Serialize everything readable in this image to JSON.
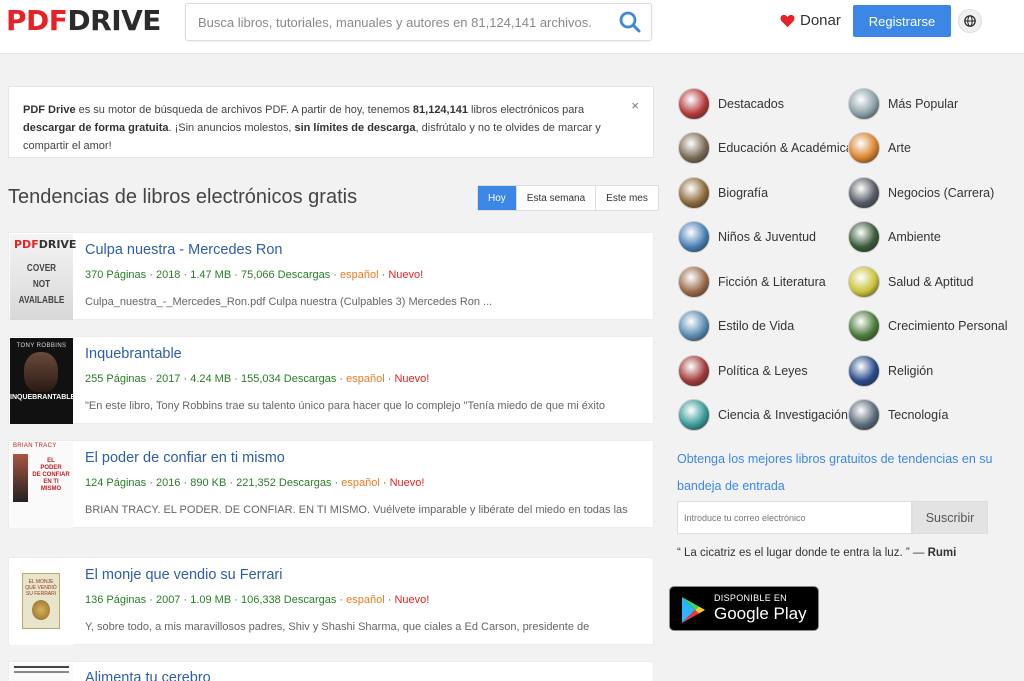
{
  "header": {
    "logo_pdf": "PDF",
    "logo_drive": "DRIVE",
    "search_placeholder": "Busca libros, tutoriales, manuales y autores en 81,124,141 archivos.",
    "donate_label": "Donar",
    "register_label": "Registrarse",
    "search_icon": "search-icon",
    "language_icon": "globe-icon"
  },
  "notice": {
    "p1": "PDF Drive",
    "p2": " es su motor de búsqueda de archivos PDF. A partir de hoy, tenemos ",
    "p3": "81,124,141",
    "p4": " libros electrónicos para ",
    "p5": "descargar de forma gratuita",
    "p6": ". ¡Sin anuncios molestos, ",
    "p7": "sin límites de descarga",
    "p8": ", disfrútalo y no te olvides de marcar y compartir el amor!",
    "close": "×"
  },
  "trending": {
    "title": "Tendencias de libros electrónicos gratis",
    "tabs": [
      "Hoy",
      "Esta semana",
      "Este mes"
    ],
    "active_tab": "Hoy"
  },
  "books": [
    {
      "title": "Culpa nuestra - Mercedes Ron",
      "pages": "370 Páginas",
      "year": "2018",
      "size": "1.47 MB",
      "downloads": "75,066 Descargas",
      "language": "español",
      "badge": "Nuevo!",
      "description": "Culpa_nuestra_-_Mercedes_Ron.pdf Culpa nuestra (Culpables 3) Mercedes Ron  ...",
      "cover_pdf": "PDF",
      "cover_drive": "DRIVE",
      "cover_text": [
        "COVER",
        "NOT",
        "AVAILABLE"
      ]
    },
    {
      "title": "Inquebrantable",
      "pages": "255 Páginas",
      "year": "2017",
      "size": "4.24 MB",
      "downloads": "155,034 Descargas",
      "language": "español",
      "badge": "Nuevo!",
      "description": "\"En este libro, Tony Robbins trae su talento único para hacer que lo complejo \"Tenía miedo de que mi éxito",
      "cover_author": "TONY ROBBINS",
      "cover_title": "INQUEBRANTABLE"
    },
    {
      "title": "El poder de confiar en ti mismo",
      "pages": "124 Páginas",
      "year": "2016",
      "size": "890 KB",
      "downloads": "221,352 Descargas",
      "language": "español",
      "badge": "Nuevo!",
      "description": "BRIAN TRACY. EL PODER. DE CONFIAR. EN TI MISMO. Vuélvete imparable y libérate del miedo en todas las",
      "cover_author": "BRIAN TRACY",
      "cover_title": [
        "EL",
        "PODER",
        "DE CONFIAR",
        "EN TI",
        "MISMO"
      ]
    },
    {
      "title": "El monje que vendio su Ferrari",
      "pages": "136 Páginas",
      "year": "2007",
      "size": "1.09 MB",
      "downloads": "106,338 Descargas",
      "language": "español",
      "badge": "Nuevo!",
      "description": "Y, sobre todo, a mis maravillosos padres, Shiv y Shashi Sharma, que ciales a Ed Carson, presidente de",
      "cover_title": [
        "EL MONJE",
        "QUE VENDIÓ",
        "SU FERRARI"
      ]
    },
    {
      "title": "Alimenta tu cerebro"
    }
  ],
  "categories": [
    {
      "label": "Destacados",
      "icon": "destacados-icon",
      "color": "#b33a3a"
    },
    {
      "label": "Más Popular",
      "icon": "mas-popular-icon",
      "color": "#8aa0a8"
    },
    {
      "label": "Educación & Académica",
      "icon": "educacion-icon",
      "color": "#7a6a55"
    },
    {
      "label": "Arte",
      "icon": "arte-icon",
      "color": "#d9822b"
    },
    {
      "label": "Biografía",
      "icon": "biografia-icon",
      "color": "#8c6a3c"
    },
    {
      "label": "Negocios (Carrera)",
      "icon": "negocios-icon",
      "color": "#555b66"
    },
    {
      "label": "Niños & Juventud",
      "icon": "ninos-icon",
      "color": "#4a7fb5"
    },
    {
      "label": "Ambiente",
      "icon": "ambiente-icon",
      "color": "#3a5a3a"
    },
    {
      "label": "Ficción & Literatura",
      "icon": "ficcion-icon",
      "color": "#9a6a4a"
    },
    {
      "label": "Salud & Aptitud",
      "icon": "salud-icon",
      "color": "#c9c23a"
    },
    {
      "label": "Estilo de Vida",
      "icon": "estilo-icon",
      "color": "#5a8ab0"
    },
    {
      "label": "Crecimiento Personal",
      "icon": "crecimiento-icon",
      "color": "#4a7a3a"
    },
    {
      "label": "Política & Leyes",
      "icon": "politica-icon",
      "color": "#a33a3a"
    },
    {
      "label": "Religión",
      "icon": "religion-icon",
      "color": "#2a4a8a"
    },
    {
      "label": "Ciencia & Investigación",
      "icon": "ciencia-icon",
      "color": "#3a9a9a"
    },
    {
      "label": "Tecnología",
      "icon": "tecnologia-icon",
      "color": "#5a6a7a"
    }
  ],
  "newsletter": {
    "text": "Obtenga los mejores libros gratuitos de tendencias en su bandeja de entrada",
    "email_placeholder": "Introduce tu correo electrónico",
    "subscribe_label": "Suscribir"
  },
  "quote": {
    "text": "“ La cicatriz es el lugar donde te entra la luz. ” — ",
    "author": "Rumi"
  },
  "google_play": {
    "small": "DISPONIBLE EN",
    "big": "Google Play"
  },
  "colors": {
    "accent": "#3c87e6",
    "brand_red": "#e62227",
    "meta_green": "#2c7c2c",
    "title_blue": "#2f5ea8"
  }
}
